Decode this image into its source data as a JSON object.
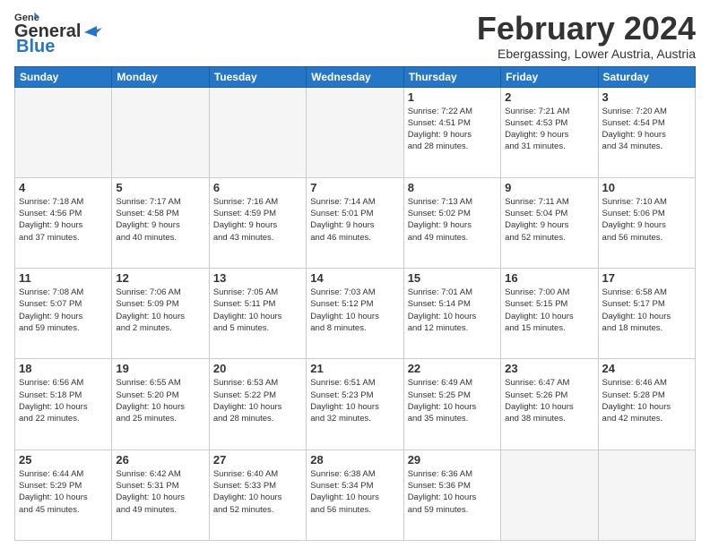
{
  "header": {
    "logo_line1": "General",
    "logo_line2": "Blue",
    "month": "February 2024",
    "location": "Ebergassing, Lower Austria, Austria"
  },
  "days_of_week": [
    "Sunday",
    "Monday",
    "Tuesday",
    "Wednesday",
    "Thursday",
    "Friday",
    "Saturday"
  ],
  "weeks": [
    [
      {
        "day": "",
        "info": ""
      },
      {
        "day": "",
        "info": ""
      },
      {
        "day": "",
        "info": ""
      },
      {
        "day": "",
        "info": ""
      },
      {
        "day": "1",
        "info": "Sunrise: 7:22 AM\nSunset: 4:51 PM\nDaylight: 9 hours\nand 28 minutes."
      },
      {
        "day": "2",
        "info": "Sunrise: 7:21 AM\nSunset: 4:53 PM\nDaylight: 9 hours\nand 31 minutes."
      },
      {
        "day": "3",
        "info": "Sunrise: 7:20 AM\nSunset: 4:54 PM\nDaylight: 9 hours\nand 34 minutes."
      }
    ],
    [
      {
        "day": "4",
        "info": "Sunrise: 7:18 AM\nSunset: 4:56 PM\nDaylight: 9 hours\nand 37 minutes."
      },
      {
        "day": "5",
        "info": "Sunrise: 7:17 AM\nSunset: 4:58 PM\nDaylight: 9 hours\nand 40 minutes."
      },
      {
        "day": "6",
        "info": "Sunrise: 7:16 AM\nSunset: 4:59 PM\nDaylight: 9 hours\nand 43 minutes."
      },
      {
        "day": "7",
        "info": "Sunrise: 7:14 AM\nSunset: 5:01 PM\nDaylight: 9 hours\nand 46 minutes."
      },
      {
        "day": "8",
        "info": "Sunrise: 7:13 AM\nSunset: 5:02 PM\nDaylight: 9 hours\nand 49 minutes."
      },
      {
        "day": "9",
        "info": "Sunrise: 7:11 AM\nSunset: 5:04 PM\nDaylight: 9 hours\nand 52 minutes."
      },
      {
        "day": "10",
        "info": "Sunrise: 7:10 AM\nSunset: 5:06 PM\nDaylight: 9 hours\nand 56 minutes."
      }
    ],
    [
      {
        "day": "11",
        "info": "Sunrise: 7:08 AM\nSunset: 5:07 PM\nDaylight: 9 hours\nand 59 minutes."
      },
      {
        "day": "12",
        "info": "Sunrise: 7:06 AM\nSunset: 5:09 PM\nDaylight: 10 hours\nand 2 minutes."
      },
      {
        "day": "13",
        "info": "Sunrise: 7:05 AM\nSunset: 5:11 PM\nDaylight: 10 hours\nand 5 minutes."
      },
      {
        "day": "14",
        "info": "Sunrise: 7:03 AM\nSunset: 5:12 PM\nDaylight: 10 hours\nand 8 minutes."
      },
      {
        "day": "15",
        "info": "Sunrise: 7:01 AM\nSunset: 5:14 PM\nDaylight: 10 hours\nand 12 minutes."
      },
      {
        "day": "16",
        "info": "Sunrise: 7:00 AM\nSunset: 5:15 PM\nDaylight: 10 hours\nand 15 minutes."
      },
      {
        "day": "17",
        "info": "Sunrise: 6:58 AM\nSunset: 5:17 PM\nDaylight: 10 hours\nand 18 minutes."
      }
    ],
    [
      {
        "day": "18",
        "info": "Sunrise: 6:56 AM\nSunset: 5:18 PM\nDaylight: 10 hours\nand 22 minutes."
      },
      {
        "day": "19",
        "info": "Sunrise: 6:55 AM\nSunset: 5:20 PM\nDaylight: 10 hours\nand 25 minutes."
      },
      {
        "day": "20",
        "info": "Sunrise: 6:53 AM\nSunset: 5:22 PM\nDaylight: 10 hours\nand 28 minutes."
      },
      {
        "day": "21",
        "info": "Sunrise: 6:51 AM\nSunset: 5:23 PM\nDaylight: 10 hours\nand 32 minutes."
      },
      {
        "day": "22",
        "info": "Sunrise: 6:49 AM\nSunset: 5:25 PM\nDaylight: 10 hours\nand 35 minutes."
      },
      {
        "day": "23",
        "info": "Sunrise: 6:47 AM\nSunset: 5:26 PM\nDaylight: 10 hours\nand 38 minutes."
      },
      {
        "day": "24",
        "info": "Sunrise: 6:46 AM\nSunset: 5:28 PM\nDaylight: 10 hours\nand 42 minutes."
      }
    ],
    [
      {
        "day": "25",
        "info": "Sunrise: 6:44 AM\nSunset: 5:29 PM\nDaylight: 10 hours\nand 45 minutes."
      },
      {
        "day": "26",
        "info": "Sunrise: 6:42 AM\nSunset: 5:31 PM\nDaylight: 10 hours\nand 49 minutes."
      },
      {
        "day": "27",
        "info": "Sunrise: 6:40 AM\nSunset: 5:33 PM\nDaylight: 10 hours\nand 52 minutes."
      },
      {
        "day": "28",
        "info": "Sunrise: 6:38 AM\nSunset: 5:34 PM\nDaylight: 10 hours\nand 56 minutes."
      },
      {
        "day": "29",
        "info": "Sunrise: 6:36 AM\nSunset: 5:36 PM\nDaylight: 10 hours\nand 59 minutes."
      },
      {
        "day": "",
        "info": ""
      },
      {
        "day": "",
        "info": ""
      }
    ]
  ]
}
